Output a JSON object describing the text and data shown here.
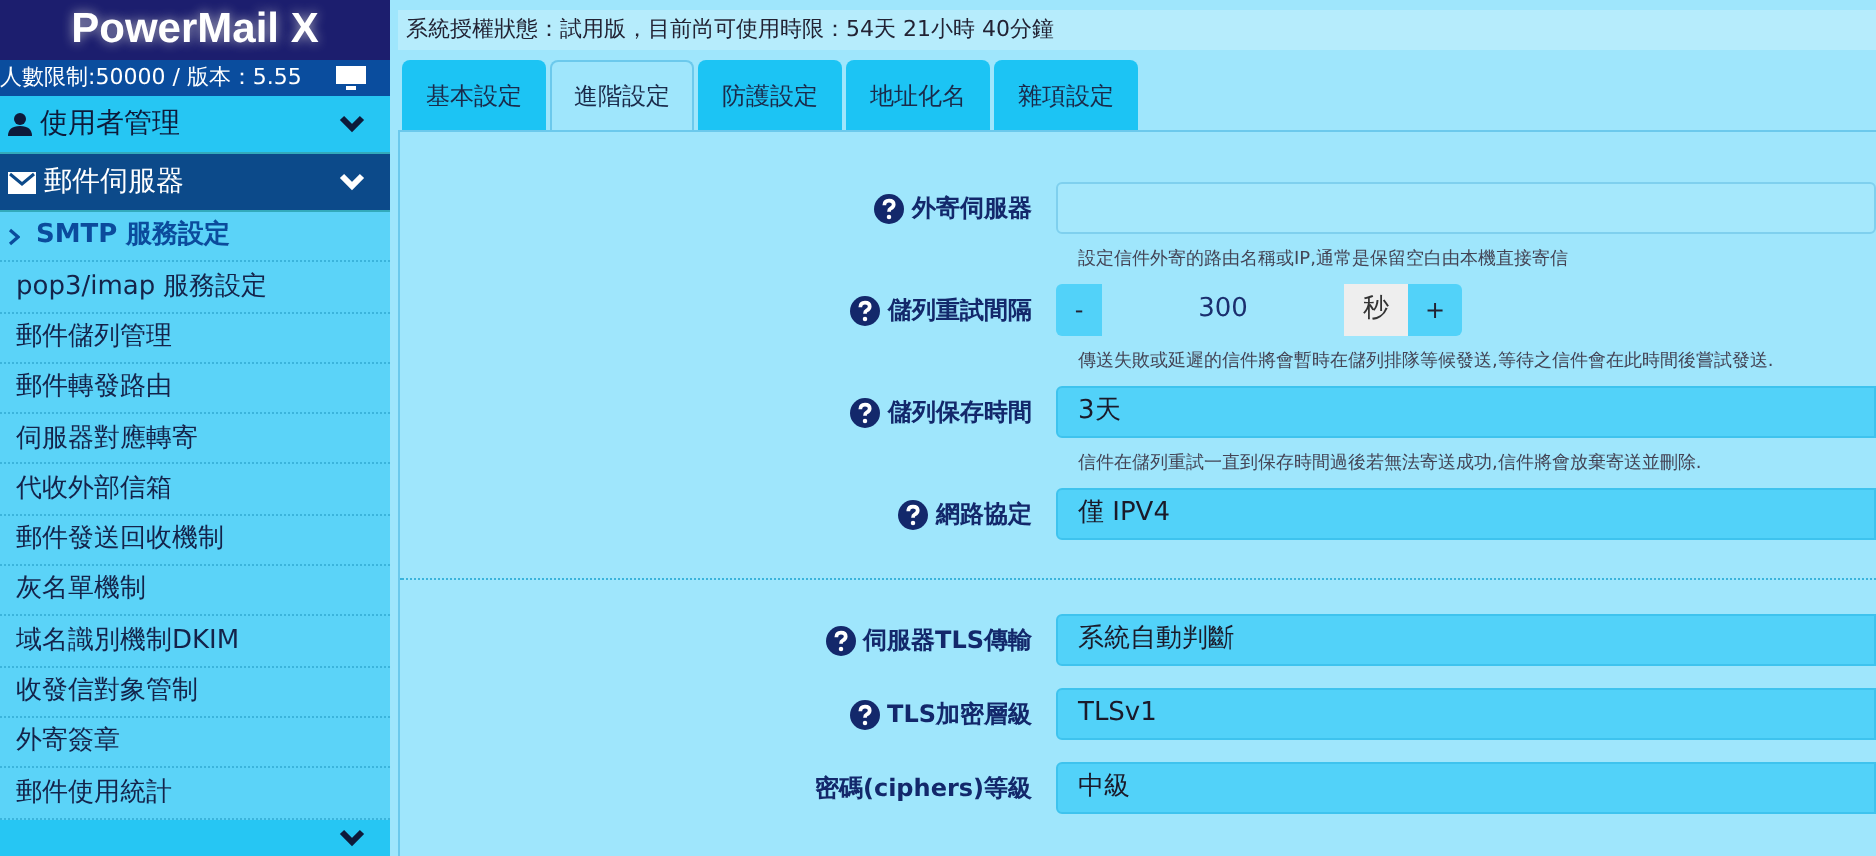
{
  "app": {
    "title": "PowerMail X",
    "info": "人數限制:50000 / 版本：5.55"
  },
  "sidebar": {
    "sections": [
      {
        "label": "使用者管理",
        "selected": false
      },
      {
        "label": "郵件伺服器",
        "selected": true,
        "items": [
          {
            "label": "SMTP 服務設定",
            "selected": true
          },
          {
            "label": "pop3/imap 服務設定",
            "selected": false
          },
          {
            "label": "郵件儲列管理",
            "selected": false
          },
          {
            "label": "郵件轉發路由",
            "selected": false
          },
          {
            "label": "伺服器對應轉寄",
            "selected": false
          },
          {
            "label": "代收外部信箱",
            "selected": false
          },
          {
            "label": "郵件發送回收機制",
            "selected": false
          },
          {
            "label": "灰名單機制",
            "selected": false
          },
          {
            "label": "域名識別機制DKIM",
            "selected": false
          },
          {
            "label": "收發信對象管制",
            "selected": false
          },
          {
            "label": "外寄簽章",
            "selected": false
          },
          {
            "label": "郵件使用統計",
            "selected": false
          }
        ]
      }
    ]
  },
  "license": "系統授權狀態：試用版，目前尚可使用時限：54天 21小時 40分鐘",
  "tabs": [
    {
      "label": "基本設定",
      "selected": false
    },
    {
      "label": "進階設定",
      "selected": true
    },
    {
      "label": "防護設定",
      "selected": false
    },
    {
      "label": "地址化名",
      "selected": false
    },
    {
      "label": "雜項設定",
      "selected": false
    }
  ],
  "groups": [
    {
      "rows": [
        {
          "kind": "text",
          "label": "外寄伺服器",
          "help": true,
          "hint": "設定信件外寄的路由名稱或IP,通常是保留空白由本機直接寄信"
        },
        {
          "kind": "stepper",
          "label": "儲列重試間隔",
          "help": true,
          "minus": "-",
          "value": "300",
          "unit": "秒",
          "plus": "+",
          "hint": "傳送失敗或延遲的信件將會暫時在儲列排隊等候發送,等待之信件會在此時間後嘗試發送."
        },
        {
          "kind": "select",
          "label": "儲列保存時間",
          "help": true,
          "value": "3天",
          "hint": "信件在儲列重試一直到保存時間過後若無法寄送成功,信件將會放棄寄送並刪除."
        },
        {
          "kind": "select",
          "label": "網路協定",
          "help": true,
          "value": "僅 IPV4"
        }
      ]
    },
    {
      "rows": [
        {
          "kind": "select",
          "label": "伺服器TLS傳輸",
          "help": true,
          "value": "系統自動判斷"
        },
        {
          "kind": "select",
          "label": "TLS加密層級",
          "help": true,
          "value": "TLSv1"
        },
        {
          "kind": "select",
          "label": "密碼(ciphers)等級",
          "help": false,
          "value": "中級"
        }
      ]
    }
  ]
}
